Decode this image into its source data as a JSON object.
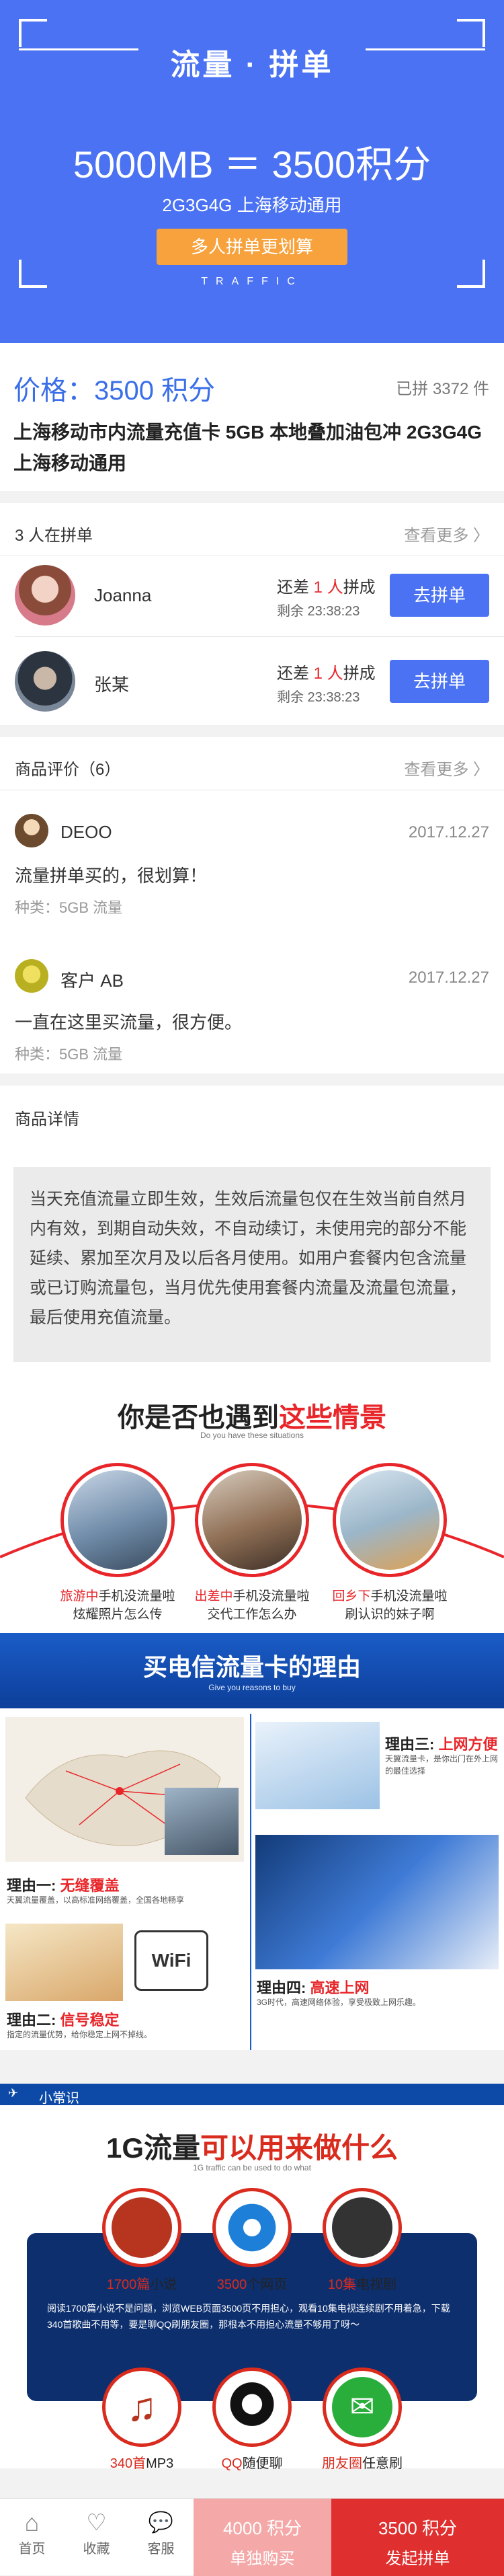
{
  "banner": {
    "title": "流量 · 拼单",
    "amount": "5000MB ＝ 3500积分",
    "subtitle": "2G3G4G 上海移动通用",
    "cta": "多人拼单更划算",
    "traffic": "TRAFFIC"
  },
  "product": {
    "price": "价格：3500 积分",
    "sold": "已拼 3372 件",
    "title": "上海移动市内流量充值卡 5GB 本地叠加油包冲 2G3G4G 上海移动通用"
  },
  "group": {
    "header": "3 人在拼单",
    "more": "查看更多",
    "items": [
      {
        "name": "Joanna",
        "still_prefix": "还差",
        "count": "1 人",
        "still_suffix": "拼成",
        "remain": "剩余 23:38:23",
        "button": "去拼单"
      },
      {
        "name": "张某",
        "still_prefix": "还差",
        "count": "1 人",
        "still_suffix": "拼成",
        "remain": "剩余 23:38:23",
        "button": "去拼单"
      }
    ]
  },
  "reviews": {
    "header": "商品评价（6）",
    "more": "查看更多",
    "items": [
      {
        "name": "DEOO",
        "date": "2017.12.27",
        "text": "流量拼单买的，很划算！",
        "kind": "种类：5GB 流量"
      },
      {
        "name": "客户 AB",
        "date": "2017.12.27",
        "text": "一直在这里买流量，很方便。",
        "kind": "种类：5GB 流量"
      }
    ]
  },
  "details": {
    "header": "商品详情",
    "body": "当天充值流量立即生效，生效后流量包仅在生效当前自然月内有效，到期自动失效，不自动续订，未使用完的部分不能延续、累加至次月及以后各月使用。如用户套餐内包含流量或已订购流量包，当月优先使用套餐内流量及流量包流量，最后使用充值流量。"
  },
  "promo_situations": {
    "title_black": "你是否也遇到",
    "title_red": "这些情景",
    "subtitle": "Do you have these situations",
    "items": [
      {
        "red": "旅游中",
        "black": "手机没流量啦",
        "line2": "炫耀照片怎么传"
      },
      {
        "red": "出差中",
        "black": "手机没流量啦",
        "line2": "交代工作怎么办"
      },
      {
        "red": "回乡下",
        "black": "手机没流量啦",
        "line2": "刷认识的妹子啊"
      }
    ]
  },
  "promo_reasons": {
    "title": "买电信流量卡的理由",
    "subtitle": "Give you reasons to buy",
    "r1": {
      "label": "理由一:",
      "red": "无缝覆盖",
      "desc": "天翼流量覆盖，以高标准网络覆盖，全国各地畅享"
    },
    "r2": {
      "label": "理由二:",
      "red": "信号稳定",
      "desc": "指定的流量优势，给你稳定上网不掉线。"
    },
    "r3": {
      "label": "理由三:",
      "red": "上网方便",
      "desc": "天翼流量卡，是你出门在外上网的最佳选择"
    },
    "r4": {
      "label": "理由四:",
      "red": "高速上网",
      "desc": "3G时代，高速网络体验，享受极致上网乐趣。"
    },
    "wifi": "WiFi"
  },
  "tips": {
    "bar": "小常识",
    "title_black": "1G流量",
    "title_red": "可以用来做什么",
    "subtitle": "1G traffic can be used to do what",
    "row1": [
      {
        "red": "1700篇",
        "black": "小说"
      },
      {
        "red": "3500",
        "black": "个网页"
      },
      {
        "red": "10集",
        "black": "电视剧"
      }
    ],
    "panel_text": "阅读1700篇小说不是问题，浏览WEB页面3500页不用担心，观看10集电视连续剧不用着急，下载340首歌曲不用等，要是聊QQ刷朋友圈，那根本不用担心流量不够用了呀～",
    "row2": [
      {
        "red": "340首",
        "black": "MP3"
      },
      {
        "red": "QQ",
        "black": "随便聊"
      },
      {
        "red": "朋友圈",
        "black": "任意刷"
      }
    ]
  },
  "bottom": {
    "home": "首页",
    "fav": "收藏",
    "service": "客服",
    "solo_price": "4000 积分",
    "solo_label": "单独购买",
    "group_price": "3500 积分",
    "group_label": "发起拼单"
  }
}
